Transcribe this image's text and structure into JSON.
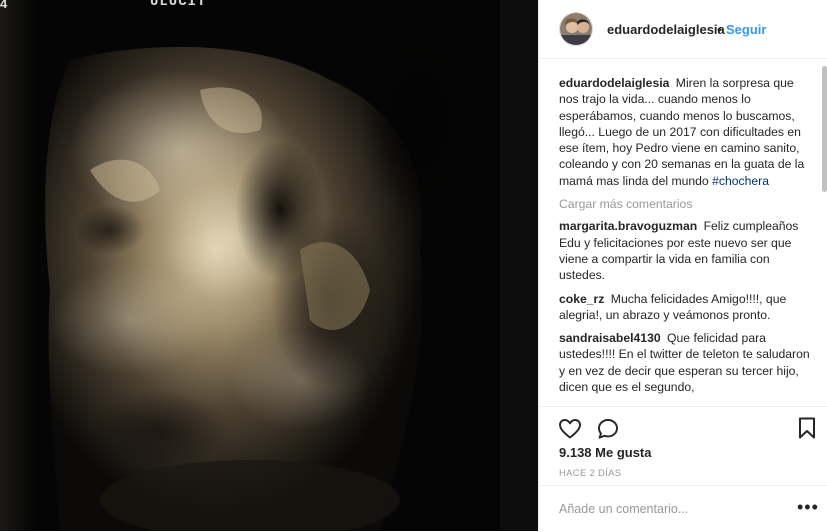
{
  "media": {
    "top_left_text": "4",
    "top_text": "ULUCIT"
  },
  "header": {
    "username": "eduardodelaiglesia",
    "separator": "•",
    "follow_label": "Seguir"
  },
  "caption": {
    "username": "eduardodelaiglesia",
    "text": "Miren la sorpresa que nos trajo la vida... cuando menos lo esperábamos, cuando menos lo buscamos, llegó... Luego de un 2017 con dificultades en ese ítem, hoy Pedro viene en camino sanito, coleando y con 20 semanas en la guata de la mamá mas linda del mundo",
    "hashtag": "#chochera"
  },
  "load_more_label": "Cargar más comentarios",
  "comments": [
    {
      "username": "margarita.bravoguzman",
      "text": "Feliz cumpleaños Edu y felicitaciones por este nuevo ser que viene a compartir la vida en familia con ustedes."
    },
    {
      "username": "coke_rz",
      "text": "Mucha felicidades Amigo!!!!, que alegria!, un abrazo y veámonos pronto."
    },
    {
      "username": "sandraisabel4130",
      "text": "Que felicidad para ustedes!!!! En el twitter de teleton te saludaron y en vez de decir que esperan su tercer hijo, dicen que es el segundo,"
    }
  ],
  "actions": {
    "likes": "9.138 Me gusta",
    "timestamp": "HACE 2 DÍAS"
  },
  "add_comment": {
    "placeholder": "Añade un comentario...",
    "more_label": "•••"
  },
  "icons": {
    "like": "heart-icon",
    "comment": "comment-bubble-icon",
    "save": "bookmark-icon",
    "more": "more-options-icon"
  },
  "colors": {
    "accent": "#3897f0",
    "hashtag": "#003569",
    "muted": "#999999",
    "text": "#262626",
    "divider": "#efefef"
  }
}
